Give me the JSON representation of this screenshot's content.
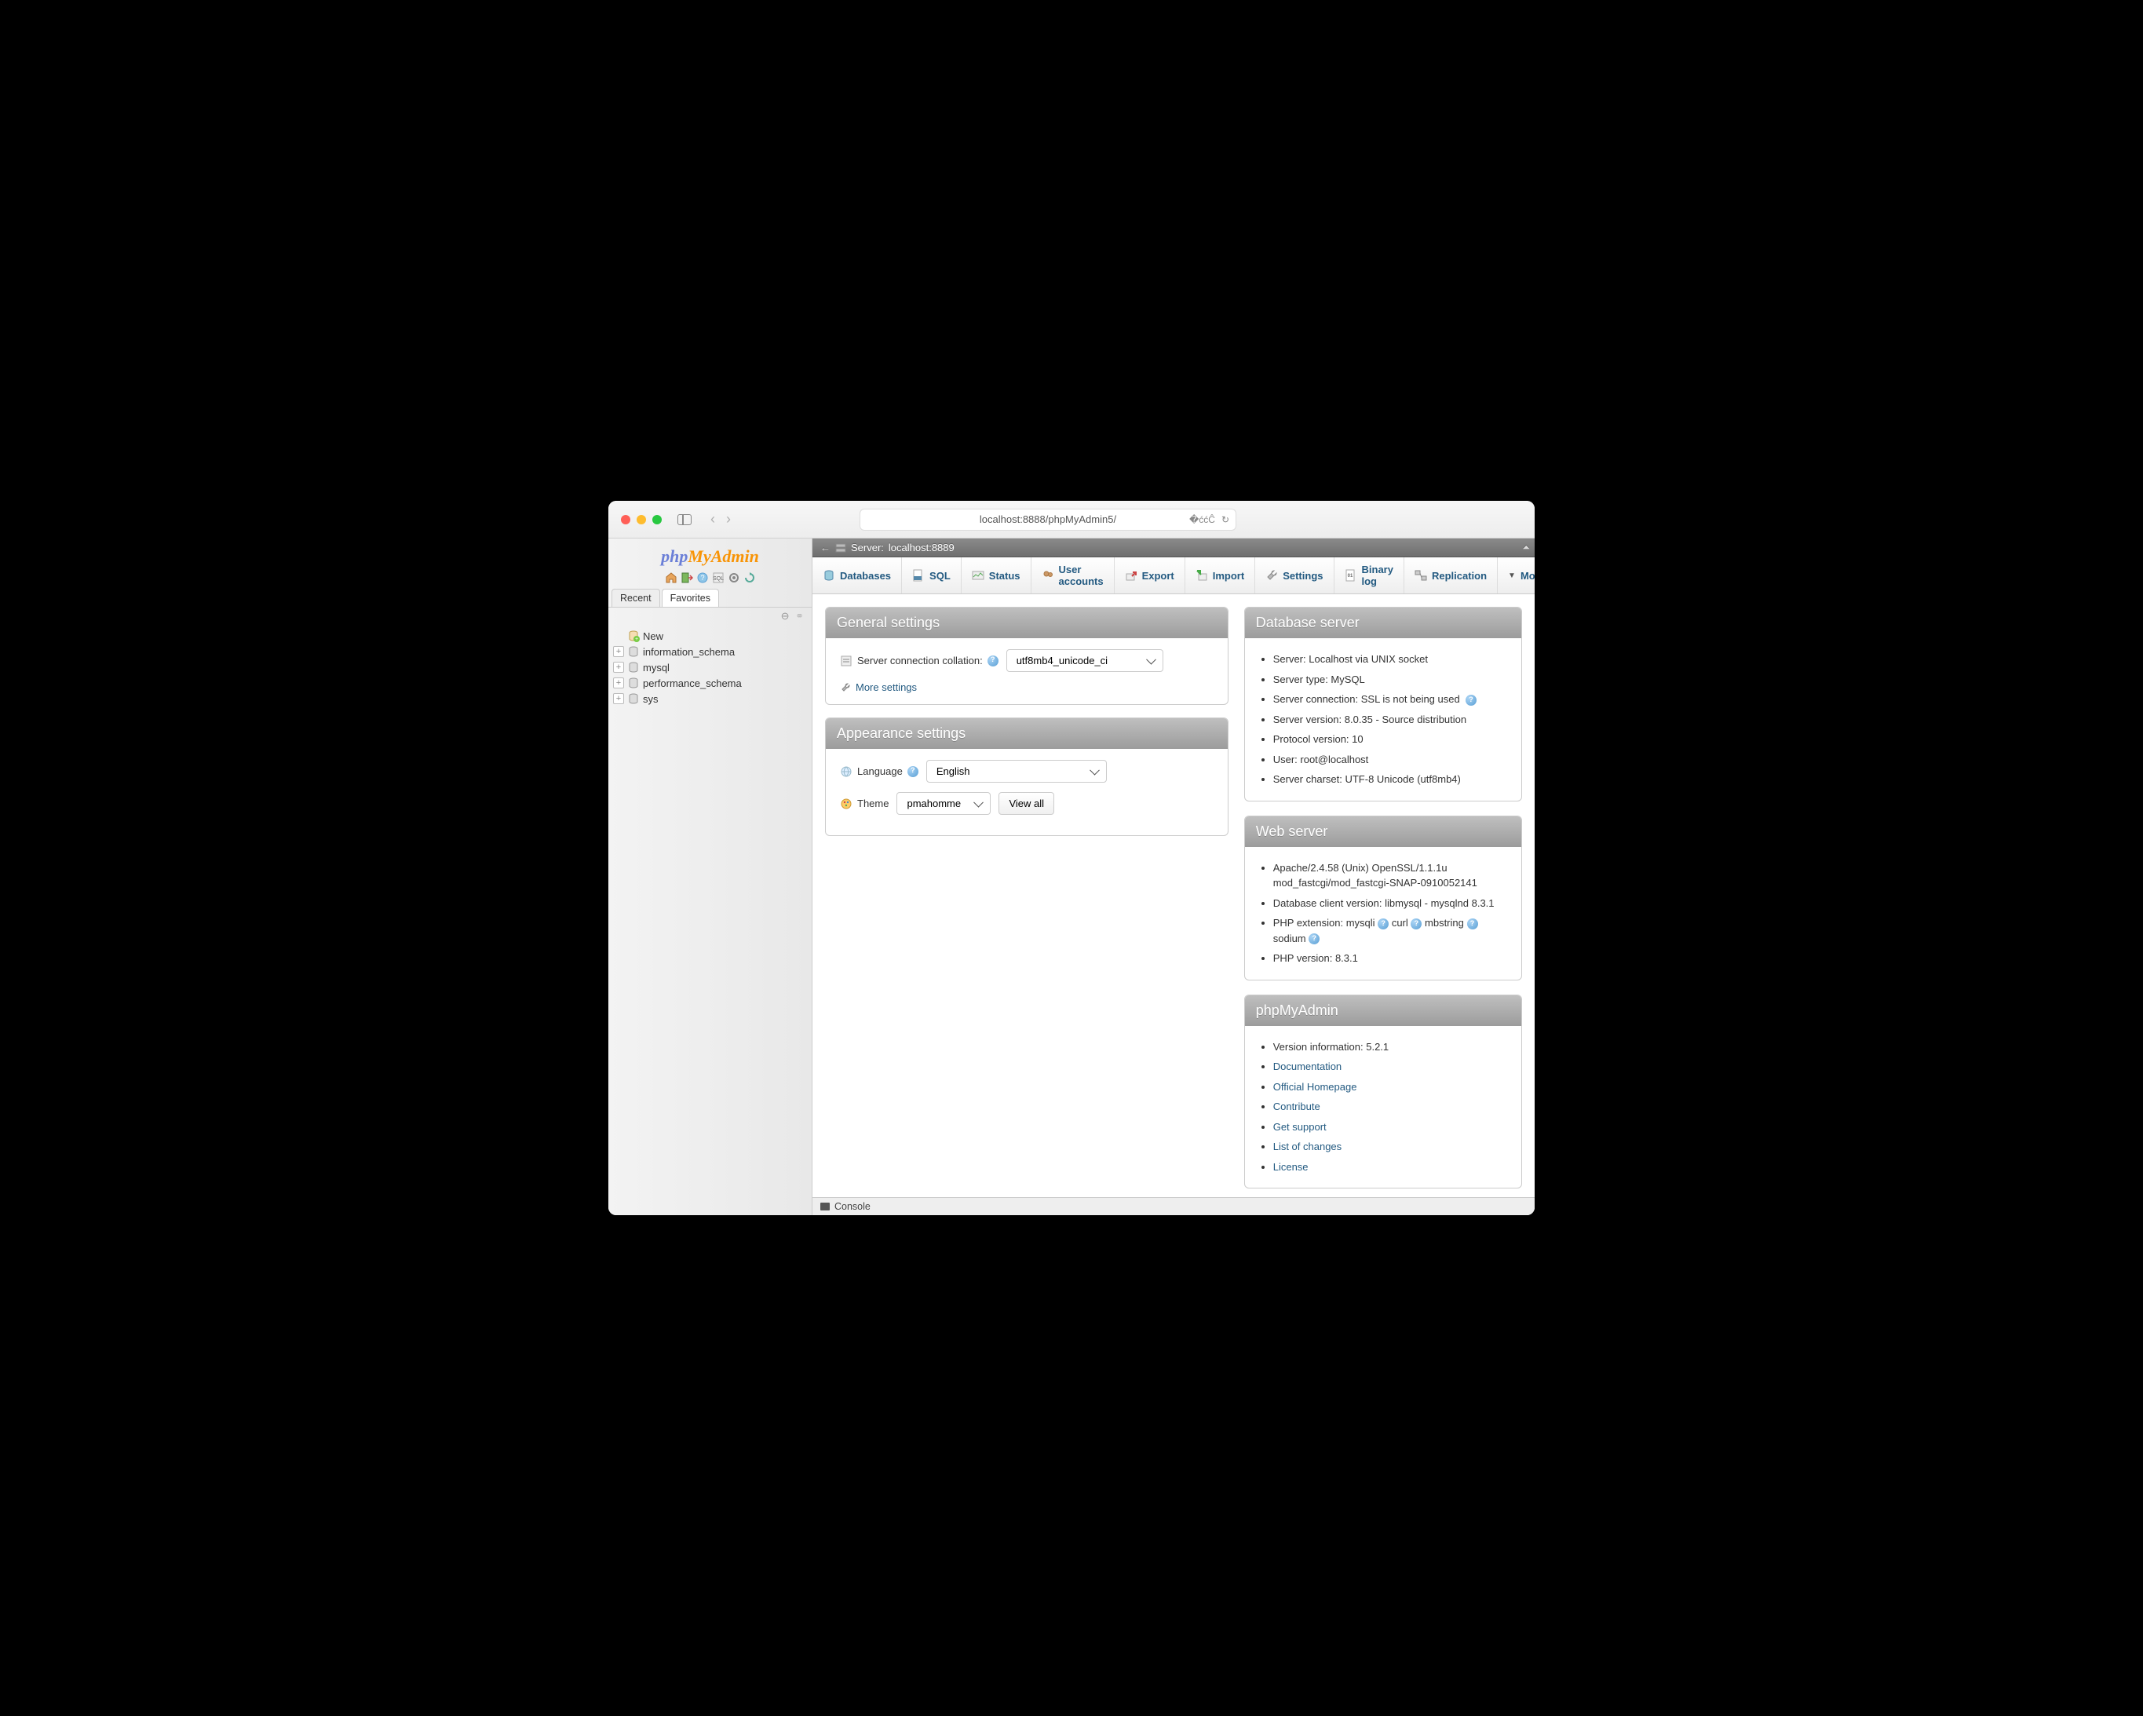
{
  "browser": {
    "url": "localhost:8888/phpMyAdmin5/"
  },
  "logo": {
    "part1": "php",
    "part2": "MyAdmin"
  },
  "sidebar_tabs": {
    "recent": "Recent",
    "favorites": "Favorites"
  },
  "tree": {
    "new": "New",
    "items": [
      "information_schema",
      "mysql",
      "performance_schema",
      "sys"
    ]
  },
  "server_bar": {
    "label": "Server:",
    "value": "localhost:8889"
  },
  "top_tabs": {
    "databases": "Databases",
    "sql": "SQL",
    "status": "Status",
    "users": "User accounts",
    "export": "Export",
    "import": "Import",
    "settings": "Settings",
    "binlog": "Binary log",
    "replication": "Replication",
    "more": "More"
  },
  "panels": {
    "general": {
      "title": "General settings",
      "collation_label": "Server connection collation:",
      "collation_value": "utf8mb4_unicode_ci",
      "more_settings": "More settings"
    },
    "appearance": {
      "title": "Appearance settings",
      "language_label": "Language",
      "language_value": "English",
      "theme_label": "Theme",
      "theme_value": "pmahomme",
      "view_all": "View all"
    },
    "dbserver": {
      "title": "Database server",
      "items": [
        "Server: Localhost via UNIX socket",
        "Server type: MySQL",
        "Server connection: SSL is not being used",
        "Server version: 8.0.35 - Source distribution",
        "Protocol version: 10",
        "User: root@localhost",
        "Server charset: UTF-8 Unicode (utf8mb4)"
      ]
    },
    "webserver": {
      "title": "Web server",
      "line1": "Apache/2.4.58 (Unix) OpenSSL/1.1.1u mod_fastcgi/mod_fastcgi-SNAP-0910052141",
      "line2": "Database client version: libmysql - mysqlnd 8.3.1",
      "line3_label": "PHP extension:",
      "ext1": "mysqli",
      "ext2": "curl",
      "ext3": "mbstring",
      "ext4": "sodium",
      "line4": "PHP version: 8.3.1"
    },
    "pma": {
      "title": "phpMyAdmin",
      "version": "Version information: 5.2.1",
      "links": [
        "Documentation",
        "Official Homepage",
        "Contribute",
        "Get support",
        "List of changes",
        "License"
      ]
    }
  },
  "console": "Console"
}
